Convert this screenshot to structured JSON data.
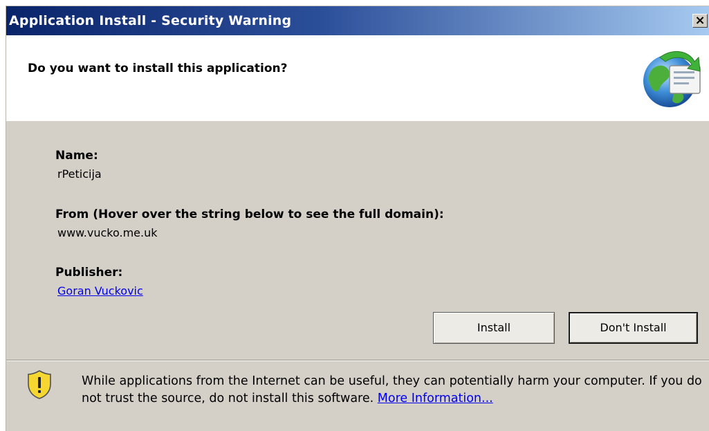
{
  "window": {
    "title": "Application Install - Security Warning",
    "close_glyph": "×"
  },
  "header": {
    "question": "Do you want to install this application?",
    "icon": "globe-install-icon"
  },
  "info": {
    "name_label": "Name:",
    "name_value": "rPeticija",
    "from_label": "From (Hover over the string below to see the full domain):",
    "from_value": "www.vucko.me.uk",
    "publisher_label": "Publisher:",
    "publisher_value": "Goran Vuckovic"
  },
  "buttons": {
    "install": "Install",
    "dont_install": "Don't Install"
  },
  "warning": {
    "icon": "shield-warning-icon",
    "text": "While applications from the Internet can be useful, they can potentially harm your computer. If you do not trust the source, do not install this software.",
    "link": "More Information..."
  },
  "colors": {
    "titlebar_start": "#0a246a",
    "titlebar_end": "#a6caf0",
    "dialog_bg": "#d4d0c8",
    "link": "#0000ee"
  }
}
